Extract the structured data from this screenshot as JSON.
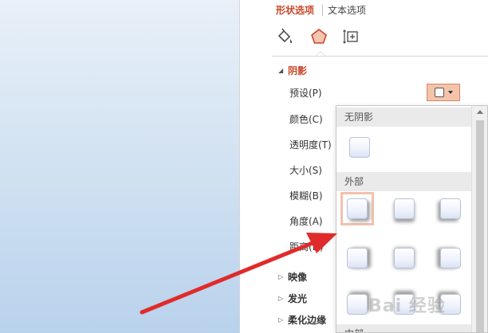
{
  "tabs": {
    "shape_options": "形状选项",
    "text_options": "文本选项"
  },
  "icons": {
    "fill_line": "paint-bucket-icon",
    "effects": "pentagon-effects-icon",
    "size_properties": "size-properties-icon"
  },
  "colors": {
    "accent": "#c8472a",
    "preset_button_bg": "#f3c4aa",
    "selected_cell_border": "#f3c1ad",
    "arrow": "#e02b2b"
  },
  "shadow_section": {
    "title": "阴影",
    "props": {
      "preset": "预设(P)",
      "color": "颜色(C)",
      "transparency": "透明度(T)",
      "size": "大小(S)",
      "blur": "模糊(B)",
      "angle": "角度(A)",
      "distance": "距离(D)"
    }
  },
  "collapsed_sections": {
    "reflection": "映像",
    "glow": "发光",
    "soft_edges": "柔化边缘"
  },
  "dropdown": {
    "header_none": "无阴影",
    "header_outer": "外部",
    "header_inner": "内部",
    "outer_presets": [
      "右下斜偏移",
      "向下偏移",
      "左下斜偏移",
      "向右偏移",
      "居中偏移",
      "向左偏移",
      "右上斜偏移",
      "向上偏移",
      "左上斜偏移"
    ],
    "selected": "右下斜偏移"
  },
  "watermark": "Bai 经验"
}
